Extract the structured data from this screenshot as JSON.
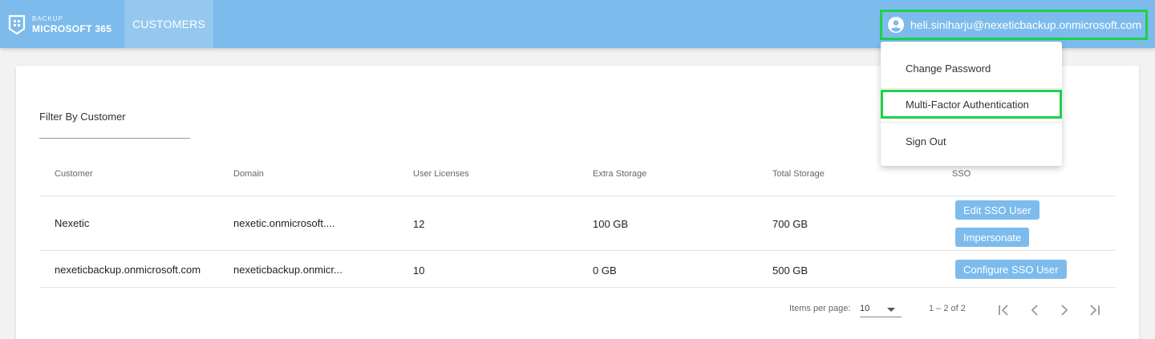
{
  "header": {
    "logo_small": "BACKUP",
    "logo_big": "MICROSOFT 365",
    "nav_tab": "CUSTOMERS",
    "user_email": "heli.siniharju@nexeticbackup.onmicrosoft.com"
  },
  "menu": {
    "items": [
      "Change Password",
      "Multi-Factor Authentication",
      "Sign Out"
    ]
  },
  "filter": {
    "label": "Filter By Customer"
  },
  "table": {
    "columns": [
      "Customer",
      "Domain",
      "User Licenses",
      "Extra Storage",
      "Total Storage",
      "SSO"
    ],
    "rows": [
      {
        "customer": "Nexetic",
        "domain": "nexetic.onmicrosoft....",
        "licenses": "12",
        "extra": "100 GB",
        "total": "700 GB",
        "sso": [
          "Edit SSO User",
          "Impersonate"
        ]
      },
      {
        "customer": "nexeticbackup.onmicrosoft.com",
        "domain": "nexeticbackup.onmicr...",
        "licenses": "10",
        "extra": "0 GB",
        "total": "500 GB",
        "sso": [
          "Configure SSO User"
        ]
      }
    ]
  },
  "paginator": {
    "label": "Items per page:",
    "page_size": "10",
    "range": "1 – 2 of 2"
  },
  "colors": {
    "header": "#7cbbec",
    "highlight": "#1ed14b",
    "button": "#7cbbec"
  },
  "icons": [
    "logo-icon",
    "account-circle-icon",
    "first-page-icon",
    "prev-page-icon",
    "next-page-icon",
    "last-page-icon",
    "dropdown-caret-icon"
  ]
}
